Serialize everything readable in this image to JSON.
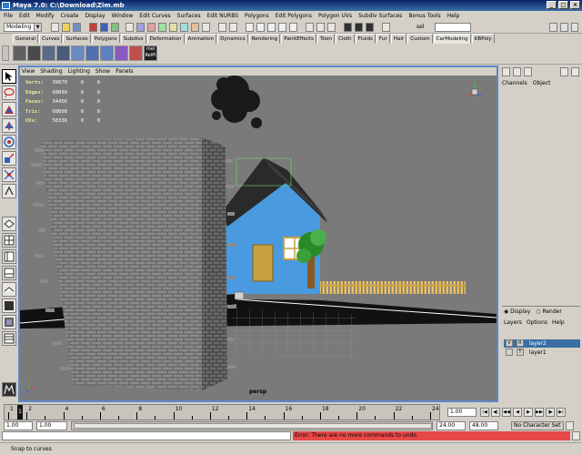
{
  "window": {
    "title": "Maya 7.0: C:\\Download\\Zim.mb"
  },
  "menubar": [
    "File",
    "Edit",
    "Modify",
    "Create",
    "Display",
    "Window",
    "Edit Curves",
    "Surfaces",
    "Edit NURBS",
    "Polygons",
    "Edit Polygons",
    "Polygon UVs",
    "Subdiv Surfaces",
    "Bonus Tools",
    "Help"
  ],
  "statusline": {
    "mode": "Modeling",
    "sel_label": "sel"
  },
  "shelf": {
    "tabs": [
      "General",
      "Curves",
      "Surfaces",
      "Polygons",
      "Subdivs",
      "Deformation",
      "Animation",
      "Dynamics",
      "Rendering",
      "PaintEffects",
      "Toon",
      "Cloth",
      "Fluids",
      "Fur",
      "Hair",
      "Custom",
      "CarModeling",
      "KBPoly"
    ],
    "active_tab": "CarModeling",
    "mel_label": "mel",
    "rel_label": "RelPl"
  },
  "viewport": {
    "menu": [
      "View",
      "Shading",
      "Lighting",
      "Show",
      "Panels"
    ],
    "hud": [
      {
        "label": "Verts:",
        "value": "39670",
        "a": "0",
        "b": "0"
      },
      {
        "label": "Edges:",
        "value": "68899",
        "a": "0",
        "b": "0"
      },
      {
        "label": "Faces:",
        "value": "34456",
        "a": "0",
        "b": "0"
      },
      {
        "label": "Tris:",
        "value": "68898",
        "a": "0",
        "b": "0"
      },
      {
        "label": "UVs:",
        "value": "50336",
        "a": "0",
        "b": "0"
      }
    ],
    "camera": "persp"
  },
  "channelbox": {
    "menu": [
      "Channels",
      "Object"
    ],
    "layer_tabs": {
      "display": "Display",
      "render": "Render"
    },
    "layer_menu": [
      "Layers",
      "Options",
      "Help"
    ],
    "layers": [
      {
        "v": "V",
        "r": "R",
        "name": "layer2",
        "selected": true
      },
      {
        "v": "",
        "r": "T",
        "name": "layer1",
        "selected": false
      }
    ]
  },
  "timeslider": {
    "ticks": [
      "1",
      "2",
      "4",
      "6",
      "8",
      "10",
      "12",
      "14",
      "16",
      "18",
      "20",
      "22",
      "24"
    ],
    "current_frame": "1",
    "current_field": "1.00"
  },
  "rangeslider": {
    "start": "1.00",
    "inner_start": "1.00",
    "inner_end": "24.00",
    "end": "48.00",
    "character_set": "No Character Set"
  },
  "cmdline": {
    "error": "Error: There are no more commands to undo."
  },
  "helpline": {
    "text": "Snap to curves"
  }
}
